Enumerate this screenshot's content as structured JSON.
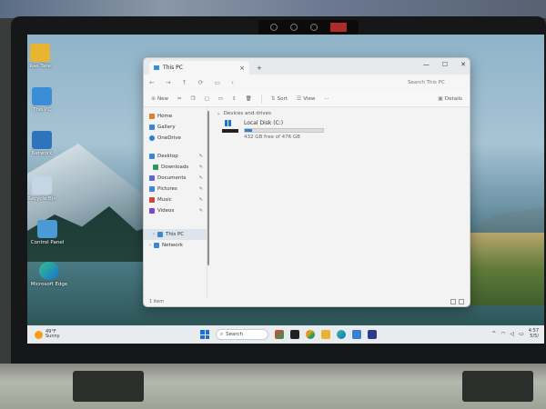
{
  "window": {
    "tab_title": "This PC",
    "tab_close": "×",
    "new_tab": "+",
    "minimize": "—",
    "maximize": "☐",
    "close": "✕"
  },
  "address": {
    "back": "←",
    "forward": "→",
    "up": "↑",
    "refresh": "⟳",
    "computer": "▭",
    "chevron": "›",
    "search_placeholder": "Search This PC"
  },
  "toolbar": {
    "new_label": "New",
    "sort_label": "Sort",
    "view_label": "View",
    "more_label": "···",
    "details_label": "Details"
  },
  "sidebar": {
    "items": [
      {
        "label": "Home",
        "color": "#d9822b"
      },
      {
        "label": "Gallery",
        "color": "#3b86d6"
      },
      {
        "label": "OneDrive",
        "color": "#2d7fd3"
      }
    ],
    "quick": [
      {
        "label": "Desktop",
        "color": "#3b86d6"
      },
      {
        "label": "Downloads",
        "color": "#2a9a5a"
      },
      {
        "label": "Documents",
        "color": "#5a6ad0"
      },
      {
        "label": "Pictures",
        "color": "#3b86d6"
      },
      {
        "label": "Music",
        "color": "#d0453b"
      },
      {
        "label": "Videos",
        "color": "#7a4bc8"
      }
    ],
    "bottom": [
      {
        "label": "This PC",
        "color": "#3b86d6"
      },
      {
        "label": "Network",
        "color": "#3b86d6"
      }
    ]
  },
  "content": {
    "section": "Devices and drives",
    "drive_name": "Local Disk (C:)",
    "drive_free": "432 GB free of 476 GB",
    "drive_used_fraction": 0.09
  },
  "status": {
    "items": "1 item"
  },
  "desktop_icons": [
    {
      "label": "Rae Tate"
    },
    {
      "label": "This PC"
    },
    {
      "label": "Network"
    },
    {
      "label": "Recycle Bin"
    },
    {
      "label": "Control Panel"
    },
    {
      "label": "Microsoft Edge"
    }
  ],
  "taskbar": {
    "temp": "49°F",
    "condition": "Sunny",
    "search": "Search",
    "time": "4:57",
    "date": "5/5/"
  }
}
